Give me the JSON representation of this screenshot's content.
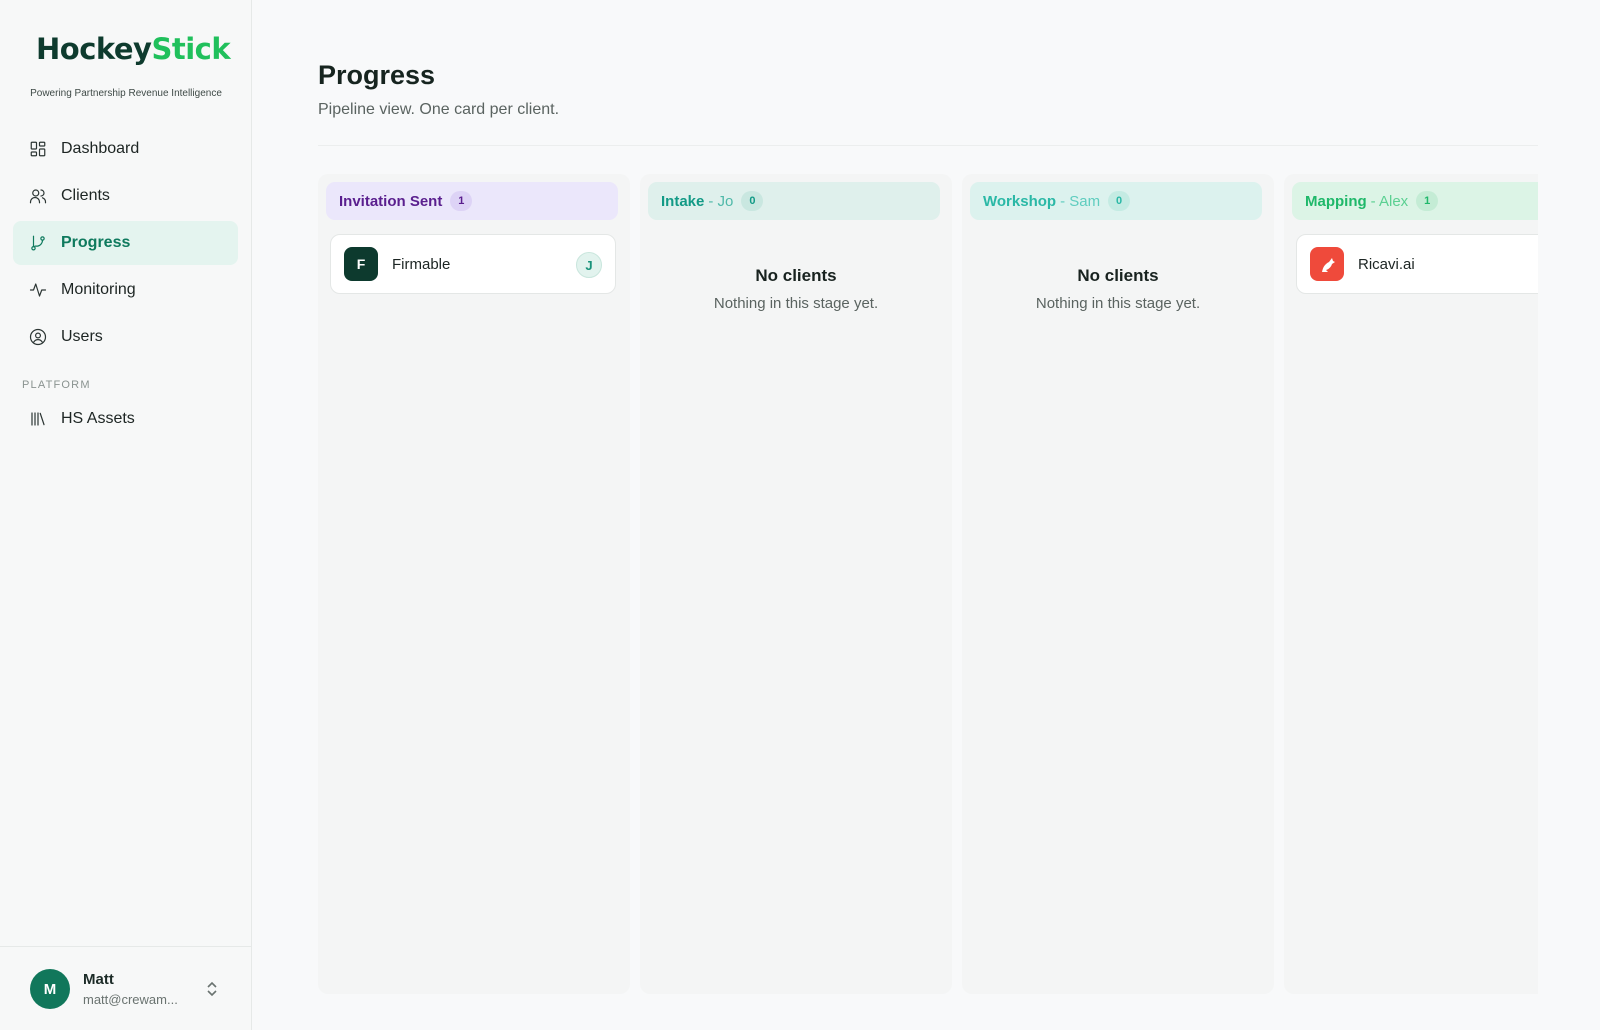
{
  "brand": {
    "logo_part1": "Hockey",
    "logo_part2": "Stick",
    "tagline": "Powering Partnership Revenue Intelligence",
    "accent": "#20c05c"
  },
  "sidebar": {
    "items": [
      {
        "label": "Dashboard",
        "icon": "dashboard-icon"
      },
      {
        "label": "Clients",
        "icon": "users-icon"
      },
      {
        "label": "Progress",
        "icon": "git-branch-icon",
        "active": true
      },
      {
        "label": "Monitoring",
        "icon": "activity-icon"
      },
      {
        "label": "Users",
        "icon": "user-circle-icon"
      }
    ],
    "section_label": "PLATFORM",
    "platform_items": [
      {
        "label": "HS Assets",
        "icon": "library-icon"
      }
    ]
  },
  "user": {
    "initial": "M",
    "name": "Matt",
    "email": "matt@crewam..."
  },
  "page": {
    "title": "Progress",
    "subtitle": "Pipeline view. One card per client."
  },
  "columns": [
    {
      "title": "Invitation Sent",
      "owner": "",
      "count": "1",
      "cards": [
        {
          "initial": "F",
          "name": "Firmable",
          "assignee": "J"
        }
      ]
    },
    {
      "title": "Intake",
      "owner": "- Jo",
      "count": "0",
      "empty_title": "No clients",
      "empty_sub": "Nothing in this stage yet."
    },
    {
      "title": "Workshop",
      "owner": "- Sam",
      "count": "0",
      "empty_title": "No clients",
      "empty_sub": "Nothing in this stage yet."
    },
    {
      "title": "Mapping",
      "owner": "- Alex",
      "count": "1",
      "cards": [
        {
          "name": "Ricavi.ai",
          "logo": "ricavi-logo-icon"
        }
      ]
    }
  ]
}
